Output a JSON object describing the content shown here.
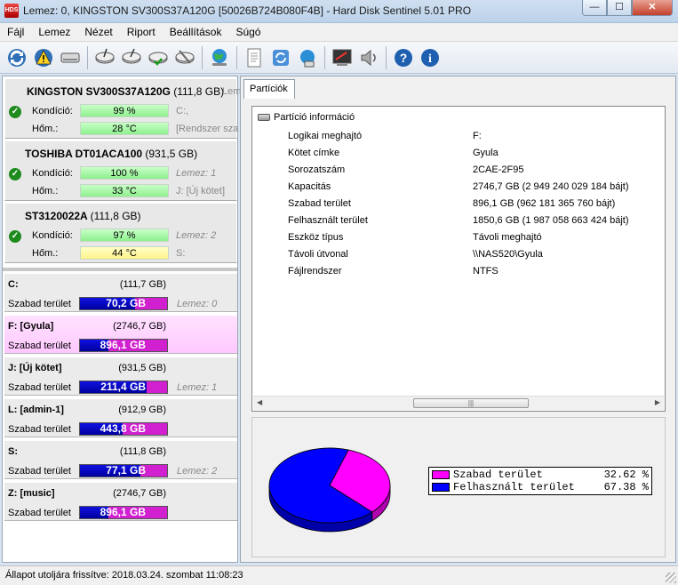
{
  "window": {
    "title": "Lemez: 0, KINGSTON SV300S37A120G [50026B724B080F4B]  -  Hard Disk Sentinel 5.01 PRO",
    "buttons": {
      "minimize": "—",
      "maximize": "☐",
      "close": "✕"
    }
  },
  "menu": [
    "Fájl",
    "Lemez",
    "Nézet",
    "Riport",
    "Beállítások",
    "Súgó"
  ],
  "toolbar": {
    "icons": [
      "refresh-icon",
      "warning-icon",
      "drive-icon",
      "disk-test-icon",
      "disk-surface-icon",
      "disk-ok-icon",
      "disk-tool-icon",
      "globe-icon",
      "report-icon",
      "sync-icon",
      "network-icon",
      "terminal-icon",
      "speaker-icon",
      "help-icon",
      "info-icon"
    ]
  },
  "disks": [
    {
      "name": "KINGSTON SV300S37A120G",
      "size": "(111,8 GB)",
      "extra": "Lem",
      "health_label": "Kondíció:",
      "health": "99 %",
      "temp_label": "Hőm.:",
      "temp": "28 °C",
      "temp_color": "green",
      "side1": "C:,",
      "side2": "[Rendszer sza"
    },
    {
      "name": "TOSHIBA DT01ACA100",
      "size": "(931,5 GB)",
      "extra": "",
      "health_label": "Kondíció:",
      "health": "100 %",
      "temp_label": "Hőm.:",
      "temp": "33 °C",
      "temp_color": "green",
      "side1": "Lemez: 1",
      "side2": "J: [Új kötet]"
    },
    {
      "name": "ST3120022A",
      "size": "(111,8 GB)",
      "extra": "",
      "health_label": "Kondíció:",
      "health": "97 %",
      "temp_label": "Hőm.:",
      "temp": "44 °C",
      "temp_color": "yellow",
      "side1": "Lemez: 2",
      "side2": "S:"
    }
  ],
  "partitions": [
    {
      "name": "C:",
      "size": "(111,7 GB)",
      "free_label": "Szabad terület",
      "free": "70,2 GB",
      "free_fraction": 0.63,
      "disk": "Lemez: 0",
      "selected": false
    },
    {
      "name": "F: [Gyula]",
      "size": "(2746,7 GB)",
      "free_label": "Szabad terület",
      "free": "896,1 GB",
      "free_fraction": 0.33,
      "disk": "",
      "selected": true
    },
    {
      "name": "J: [Új kötet]",
      "size": "(931,5 GB)",
      "free_label": "Szabad terület",
      "free": "211,4 GB",
      "free_fraction": 0.77,
      "disk": "Lemez: 1",
      "selected": false
    },
    {
      "name": "L: [admin-1]",
      "size": "(912,9 GB)",
      "free_label": "Szabad terület",
      "free": "443,8 GB",
      "free_fraction": 0.49,
      "disk": "",
      "selected": false
    },
    {
      "name": "S:",
      "size": "(111,8 GB)",
      "free_label": "Szabad terület",
      "free": "77,1 GB",
      "free_fraction": 0.69,
      "disk": "Lemez: 2",
      "selected": false
    },
    {
      "name": "Z: [music]",
      "size": "(2746,7 GB)",
      "free_label": "Szabad terület",
      "free": "896,1 GB",
      "free_fraction": 0.33,
      "disk": "",
      "selected": false
    }
  ],
  "right": {
    "tab": "Partíciók",
    "info_header": "Partíció információ",
    "info": [
      {
        "k": "Logikai meghajtó",
        "v": "F:"
      },
      {
        "k": "Kötet címke",
        "v": "Gyula"
      },
      {
        "k": "Sorozatszám",
        "v": "2CAE-2F95"
      },
      {
        "k": "Kapacitás",
        "v": "2746,7 GB (2 949 240 029 184 bájt)"
      },
      {
        "k": "Szabad terület",
        "v": "896,1 GB (962 181 365 760 bájt)"
      },
      {
        "k": "Felhasznált terület",
        "v": "1850,6 GB (1 987 058 663 424 bájt)"
      },
      {
        "k": "Eszköz típus",
        "v": "Távoli meghajtó"
      },
      {
        "k": "Távoli útvonal",
        "v": "\\\\NAS520\\Gyula"
      },
      {
        "k": "Fájlrendszer",
        "v": "NTFS"
      }
    ],
    "legend": [
      {
        "name": "Szabad terület",
        "value": "32.62 %",
        "color": "#ff00ff"
      },
      {
        "name": "Felhasznált terület",
        "value": "67.38 %",
        "color": "#0000ff"
      }
    ]
  },
  "chart_data": {
    "type": "pie",
    "categories": [
      "Szabad terület",
      "Felhasznált terület"
    ],
    "values": [
      32.62,
      67.38
    ],
    "colors": [
      "#ff00ff",
      "#0000ff"
    ],
    "legend_position": "right"
  },
  "status": "Állapot utoljára frissítve: 2018.03.24. szombat 11:08:23"
}
